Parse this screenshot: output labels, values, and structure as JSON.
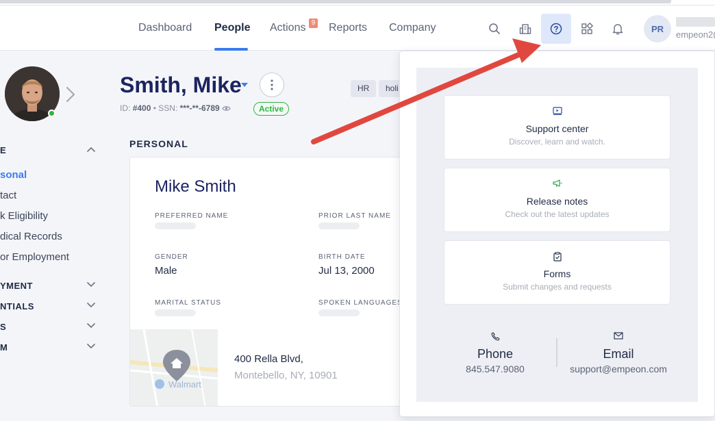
{
  "nav": {
    "items": [
      "Dashboard",
      "People",
      "Actions",
      "Reports",
      "Company"
    ],
    "active": "People",
    "actions_badge": "9"
  },
  "header_icons": [
    "search-icon",
    "org-chart-icon",
    "help-circle-icon",
    "apps-grid-icon",
    "bell-icon"
  ],
  "user": {
    "initials": "PR",
    "id_text": "empeon2("
  },
  "employee": {
    "name": "Smith, Mike",
    "id_label": "ID:",
    "id_value": "#400",
    "ssn_label": "SSN:",
    "ssn_value": "***-**-6789",
    "status": "Active",
    "tags": [
      "HR",
      "holi"
    ]
  },
  "sidebar": {
    "section_open": "E",
    "links": [
      "sonal",
      "tact",
      "k Eligibility",
      "dical Records",
      "or Employment"
    ],
    "active_link": "sonal",
    "sections_collapsed": [
      "YMENT",
      "NTIALS",
      "S",
      "M"
    ]
  },
  "personal": {
    "heading": "PERSONAL",
    "full_name": "Mike Smith",
    "fields": {
      "preferred_name_label": "PREFERRED NAME",
      "prior_last_name_label": "PRIOR LAST NAME",
      "gender_label": "GENDER",
      "gender_value": "Male",
      "birth_date_label": "BIRTH DATE",
      "birth_date_value": "Jul 13, 2000",
      "marital_status_label": "MARITAL STATUS",
      "spoken_languages_label": "SPOKEN LANGUAGES"
    },
    "address_line1": "400 Rella Blvd,",
    "address_line2": "Montebello, NY, 10901",
    "map_label": "Walmart"
  },
  "help": {
    "cards": [
      {
        "title": "Support center",
        "subtitle": "Discover, learn and watch.",
        "icon": "video-icon"
      },
      {
        "title": "Release notes",
        "subtitle": "Check out the latest updates",
        "icon": "megaphone-icon"
      },
      {
        "title": "Forms",
        "subtitle": "Submit changes and requests",
        "icon": "clipboard-icon"
      }
    ],
    "phone_title": "Phone",
    "phone_value": "845.547.9080",
    "email_title": "Email",
    "email_value": "support@empeon.com"
  },
  "colors": {
    "accent": "#3b7bf0",
    "name": "#1c2460",
    "status_green": "#2fb344",
    "annotation_arrow": "#e0483f",
    "badge": "#f08a76"
  }
}
